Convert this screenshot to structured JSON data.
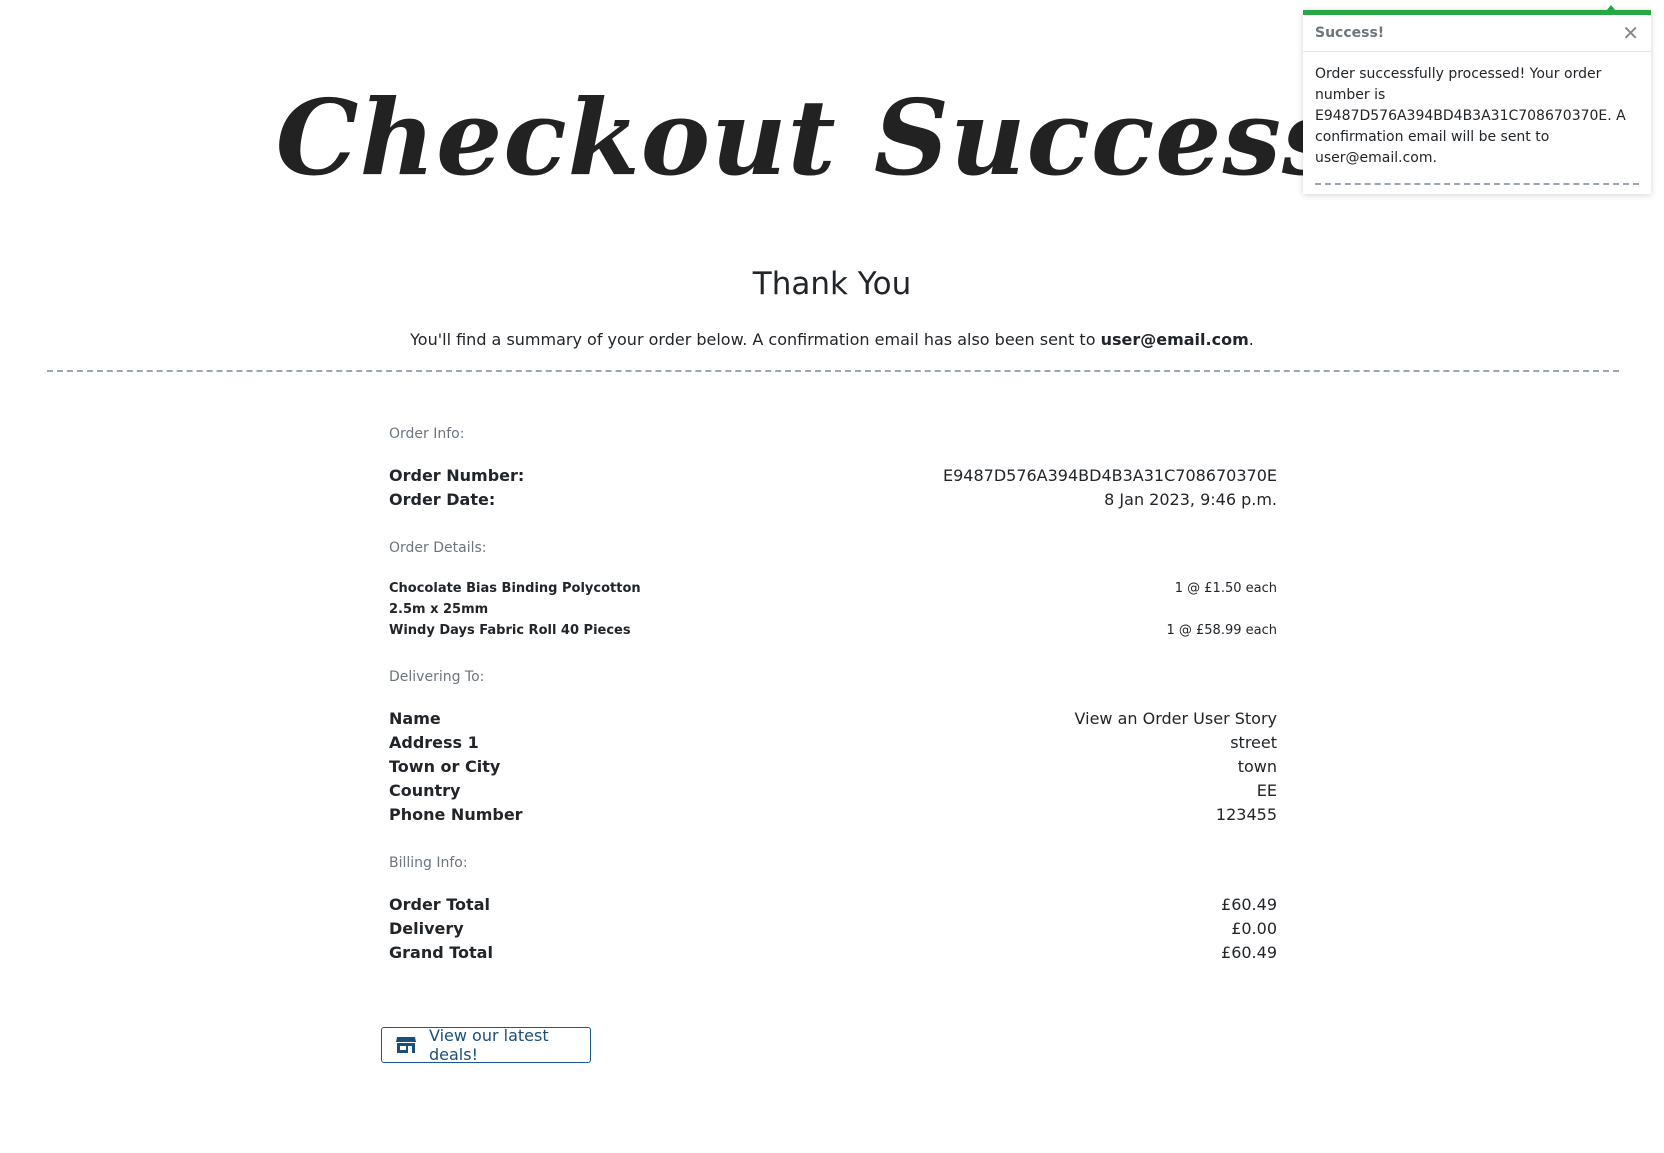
{
  "header": {
    "logo_title": "Checkout Success!"
  },
  "main": {
    "heading": "Thank You",
    "summary_prefix": "You'll find a summary of your order below. A confirmation email has also been sent to ",
    "summary_email": "user@email.com",
    "summary_suffix": "."
  },
  "order_info": {
    "section_label": "Order Info:",
    "order_number_label": "Order Number:",
    "order_number": "E9487D576A394BD4B3A31C708670370E",
    "order_date_label": "Order Date:",
    "order_date": "8 Jan 2023, 9:46 p.m."
  },
  "order_details": {
    "section_label": "Order Details:",
    "items": [
      {
        "name": "Chocolate Bias Binding Polycotton 2.5m x 25mm",
        "qty": "1 @ £1.50 each"
      },
      {
        "name": "Windy Days Fabric Roll 40 Pieces",
        "qty": "1 @ £58.99 each"
      }
    ]
  },
  "delivering_to": {
    "section_label": "Delivering To:",
    "name_label": "Name",
    "name": "View an Order User Story",
    "address1_label": "Address 1",
    "address1": "street",
    "town_label": "Town or City",
    "town": "town",
    "country_label": "Country",
    "country": "EE",
    "phone_label": "Phone Number",
    "phone": "123455"
  },
  "billing_info": {
    "section_label": "Billing Info:",
    "order_total_label": "Order Total",
    "order_total": "£60.49",
    "delivery_label": "Delivery",
    "delivery": "£0.00",
    "grand_total_label": "Grand Total",
    "grand_total": "£60.49"
  },
  "actions": {
    "deals_button_label": "View our latest deals!",
    "deals_button_icon": "store-icon"
  },
  "toast": {
    "title": "Success!",
    "close_glyph": "✕",
    "message": "Order successfully processed! Your order number is E9487D576A394BD4B3A31C708670370E. A confirmation email will be sent to user@email.com.",
    "accent_color": "#28a745"
  },
  "colors": {
    "text": "#212529",
    "muted": "#6c757d",
    "divider": "#9aa6b2",
    "button_border": "#1a5a8a"
  }
}
